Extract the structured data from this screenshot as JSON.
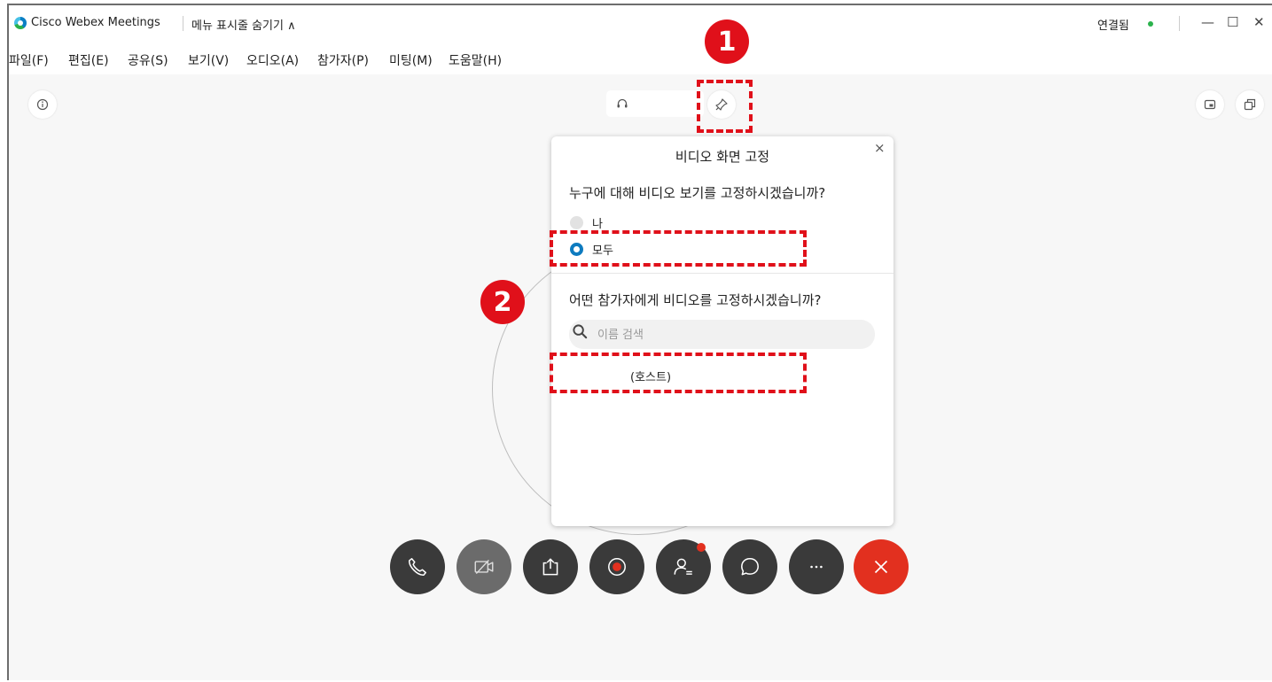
{
  "titlebar": {
    "app_title": "Cisco Webex Meetings",
    "menu_toggle": "메뉴 표시줄 숨기기 ∧",
    "connection_status": "연결됨",
    "minimize_glyph": "—",
    "maximize_glyph": "☐",
    "close_glyph": "✕"
  },
  "menubar": {
    "items": [
      {
        "label": "파일(F)"
      },
      {
        "label": "편집(E)"
      },
      {
        "label": "공유(S)"
      },
      {
        "label": "보기(V)"
      },
      {
        "label": "오디오(A)"
      },
      {
        "label": "참가자(P)"
      },
      {
        "label": "미팅(M)"
      },
      {
        "label": "도움말(H)"
      }
    ]
  },
  "pin_popup": {
    "title": "비디오 화면 고정",
    "question_who": "누구에 대해 비디오 보기를 고정하시겠습니까?",
    "options": [
      {
        "label": "나",
        "selected": false
      },
      {
        "label": "모두",
        "selected": true
      }
    ],
    "question_which": "어떤 참가자에게 비디오를 고정하시겠습니까?",
    "search_placeholder": "이름 검색",
    "search_value": "",
    "participant_host": "(호스트)",
    "close_glyph": "×"
  },
  "annotations": {
    "step1": "1",
    "step2": "2",
    "color": "#e0101a"
  },
  "controls": {
    "items": [
      {
        "icon": "phone-icon"
      },
      {
        "icon": "video-off-icon"
      },
      {
        "icon": "share-icon"
      },
      {
        "icon": "record-icon"
      },
      {
        "icon": "participants-icon"
      },
      {
        "icon": "chat-icon"
      },
      {
        "icon": "more-icon"
      },
      {
        "icon": "end-meeting-icon"
      }
    ]
  },
  "colors": {
    "accent_blue": "#0e7bbf",
    "end_red": "#e2301f",
    "connected_green": "#2bb24c"
  }
}
